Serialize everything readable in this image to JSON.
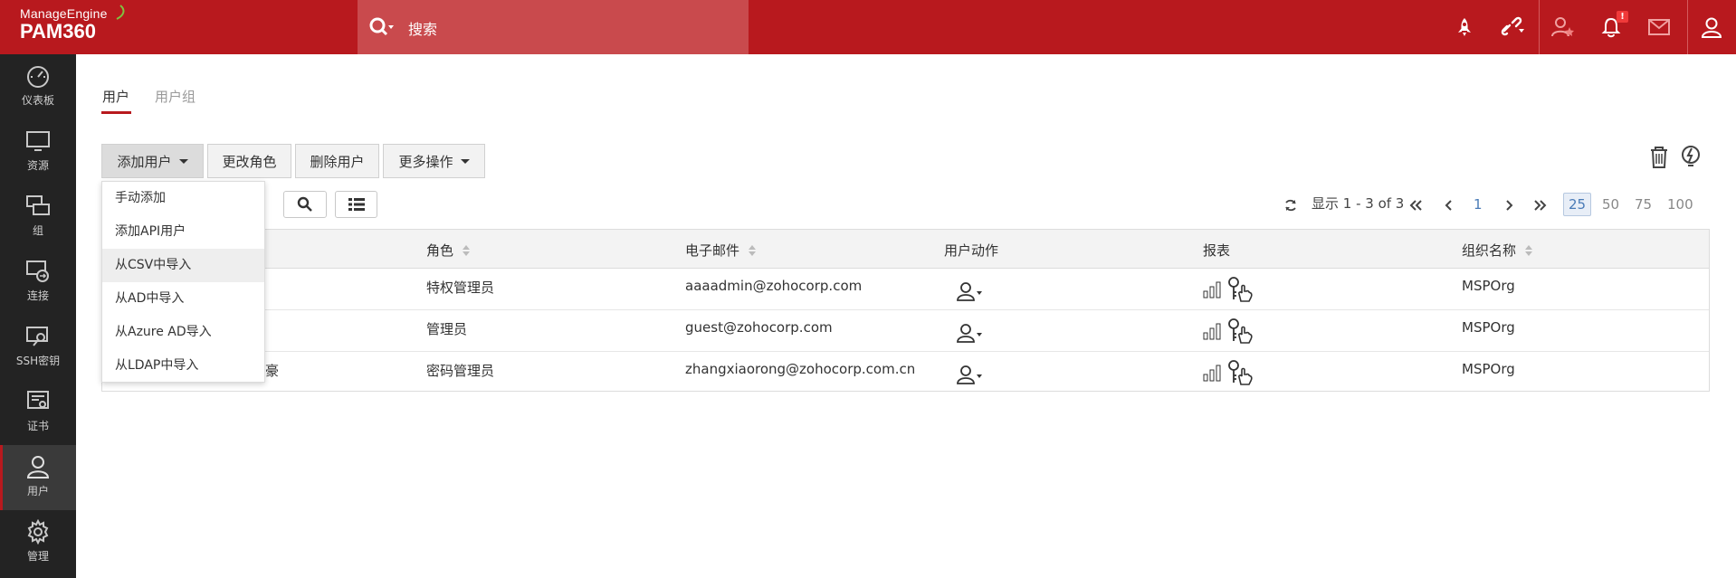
{
  "header": {
    "brand": "ManageEngine",
    "product": "PAM360",
    "search_placeholder": "搜索",
    "icons": [
      "rocket-icon",
      "link-icon",
      "user-star-icon",
      "bell-icon",
      "mail-icon",
      "user-icon"
    ],
    "notification_badge": "!"
  },
  "sidebar": {
    "items": [
      {
        "label": "仪表板",
        "icon": "dashboard-icon"
      },
      {
        "label": "资源",
        "icon": "monitor-icon"
      },
      {
        "label": "组",
        "icon": "group-icon"
      },
      {
        "label": "连接",
        "icon": "connect-icon"
      },
      {
        "label": "SSH密钥",
        "icon": "ssh-key-icon"
      },
      {
        "label": "证书",
        "icon": "certificate-icon"
      },
      {
        "label": "用户",
        "icon": "user-icon",
        "active": true
      },
      {
        "label": "管理",
        "icon": "gear-icon"
      }
    ]
  },
  "tabs": {
    "users": "用户",
    "groups": "用户组"
  },
  "toolbar": {
    "add_user": "添加用户",
    "change_role": "更改角色",
    "delete_user": "删除用户",
    "more_actions": "更多操作"
  },
  "dropdown": {
    "items": [
      "手动添加",
      "添加API用户",
      "从CSV中导入",
      "从AD中导入",
      "从Azure AD导入",
      "从LDAP中导入"
    ]
  },
  "pagination": {
    "display_text": "显示 1 - 3 of 3",
    "current_page": "1",
    "page_sizes": [
      "25",
      "50",
      "75",
      "100"
    ],
    "selected_size": "25"
  },
  "table": {
    "headers": {
      "role": "角色",
      "email": "电子邮件",
      "user_actions": "用户动作",
      "reports": "报表",
      "org": "组织名称"
    },
    "rows": [
      {
        "name_fragment": "",
        "role": "特权管理员",
        "email": "aaaadmin@zohocorp.com",
        "org": "MSPOrg"
      },
      {
        "name_fragment": "",
        "role": "管理员",
        "email": "guest@zohocorp.com",
        "org": "MSPOrg"
      },
      {
        "name_fragment": "豪",
        "role": "密码管理员",
        "email": "zhangxiaorong@zohocorp.com.cn",
        "org": "MSPOrg"
      }
    ]
  },
  "colors": {
    "brand_red": "#b8191e",
    "sidebar_bg": "#232323",
    "link_blue": "#4a7bb7"
  }
}
